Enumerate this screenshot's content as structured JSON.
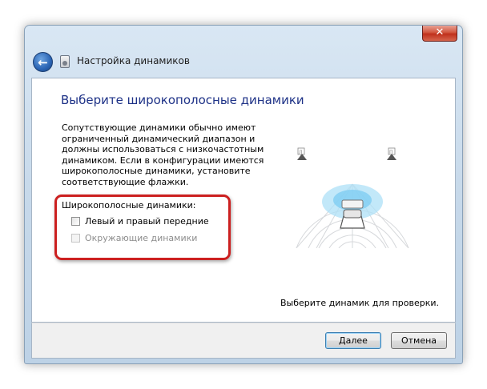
{
  "window": {
    "title": "Настройка динамиков",
    "close_label": "✕"
  },
  "header": {
    "back_glyph": "←",
    "icon": "speaker-setup-icon"
  },
  "page": {
    "heading": "Выберите широкополосные динамики",
    "description": "Сопутствующие динамики обычно имеют ограниченный динамический диапазон и должны использоваться с низкочастотным динамиком.  Если в конфигурации имеются широкополосные динамики, установите соответствующие флажки.",
    "group_label": "Широкополосные динамики:",
    "checkboxes": [
      {
        "label": "Левый и правый передние",
        "checked": false,
        "enabled": true
      },
      {
        "label": "Окружающие динамики",
        "checked": false,
        "enabled": false
      }
    ],
    "diagram": {
      "left_speaker_label": "Л",
      "right_speaker_label": "П"
    },
    "prompt": "Выберите динамик для проверки."
  },
  "footer": {
    "next_label": "Далее",
    "cancel_label": "Отмена"
  },
  "colors": {
    "heading": "#1e3287",
    "highlight_box": "#cc2020"
  }
}
